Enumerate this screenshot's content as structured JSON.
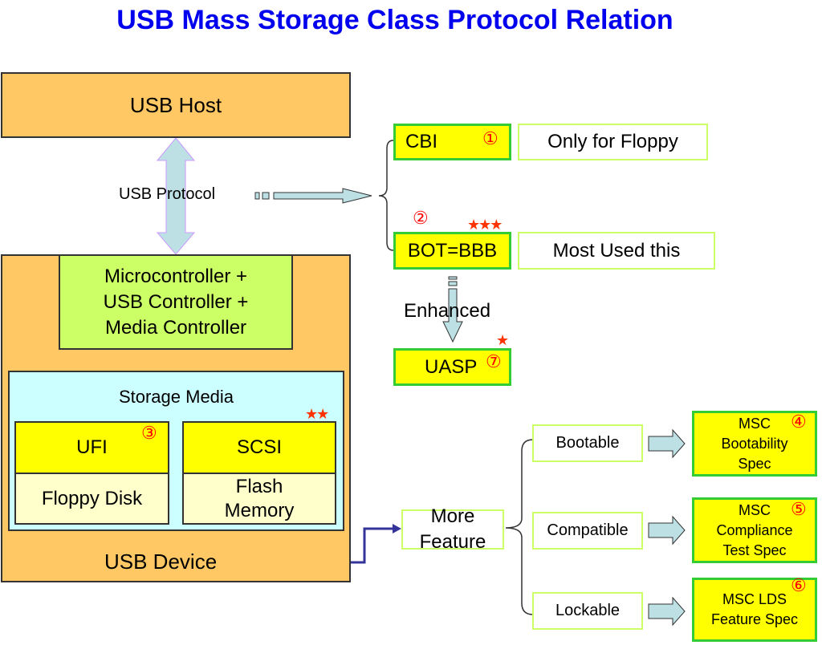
{
  "title": "USB Mass Storage Class Protocol Relation",
  "host": {
    "label": "USB Host"
  },
  "protocol": {
    "label": "USB Protocol"
  },
  "device": {
    "label": "USB Device",
    "controller": {
      "lines": [
        "Microcontroller +",
        "USB Controller +",
        "Media Controller"
      ]
    },
    "storage_media": {
      "label": "Storage Media",
      "ufi": {
        "label": "UFI",
        "badge": "③",
        "media": "Floppy Disk"
      },
      "scsi": {
        "label": "SCSI",
        "stars": "★★",
        "media_lines": [
          "Flash",
          "Memory"
        ]
      }
    }
  },
  "transports": {
    "cbi": {
      "label": "CBI",
      "badge": "①",
      "note": "Only for Floppy"
    },
    "bot": {
      "label": "BOT=BBB",
      "badge": "②",
      "stars": "★★★",
      "note": "Most Used this"
    },
    "enhanced_label": "Enhanced",
    "uasp": {
      "label": "UASP",
      "badge": "⑦",
      "stars": "★"
    }
  },
  "features": {
    "label_lines": [
      "More",
      "Feature"
    ],
    "items": [
      {
        "label": "Bootable",
        "spec_lines": [
          "MSC",
          "Bootability",
          "Spec"
        ],
        "badge": "④"
      },
      {
        "label": "Compatible",
        "spec_lines": [
          "MSC",
          "Compliance",
          "Test Spec"
        ],
        "badge": "⑤"
      },
      {
        "label": "Lockable",
        "spec_lines": [
          "MSC LDS",
          "Feature Spec"
        ],
        "badge": "⑥"
      }
    ]
  },
  "colors": {
    "title": "#0000ee",
    "orange": "#ffc864",
    "controller_green": "#ccff66",
    "storage_cyan": "#ccffff",
    "highlight_yellow": "#ffff00",
    "arrow_fill": "#bce0e4",
    "connector_blue": "#333399",
    "badge_red": "#ff0000"
  }
}
